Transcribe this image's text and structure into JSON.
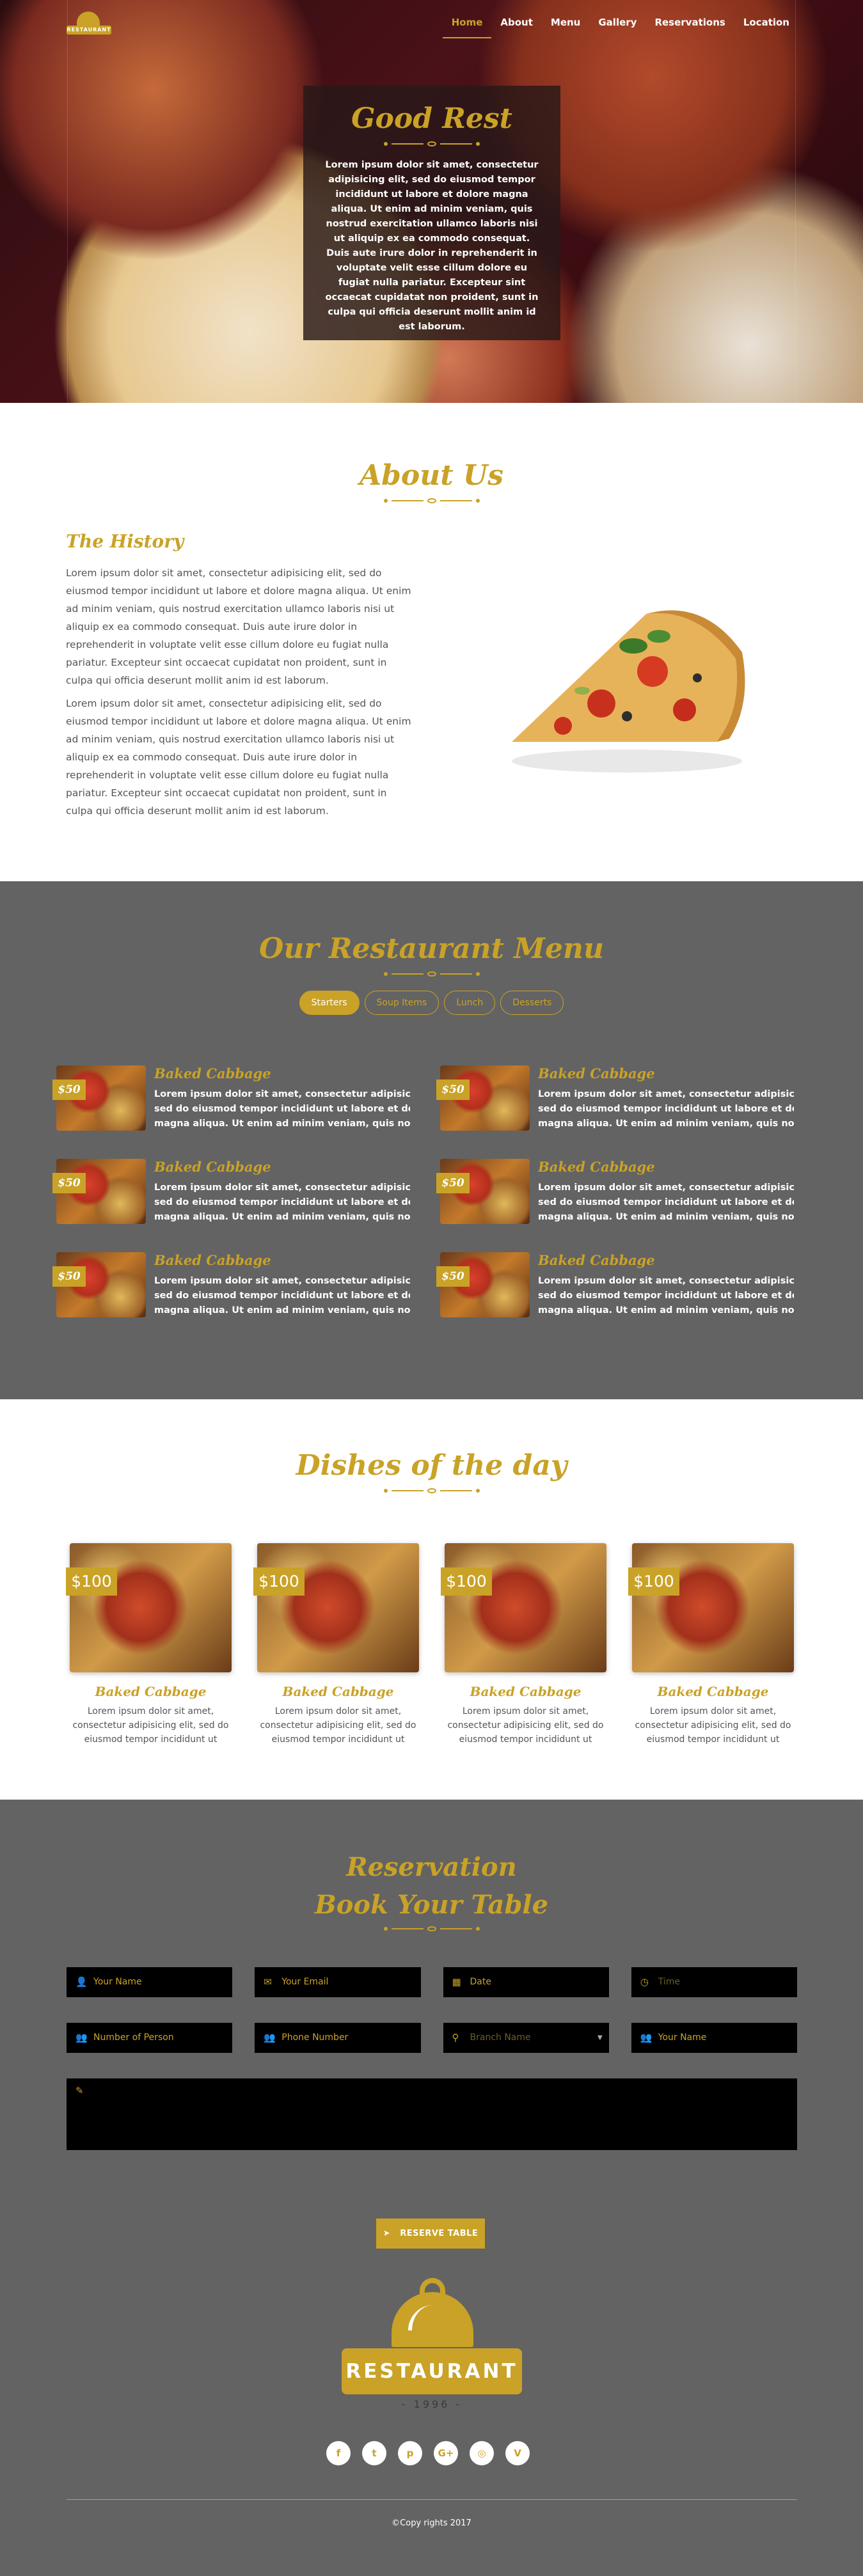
{
  "nav": {
    "logo_text": "RESTAURANT",
    "items": [
      "Home",
      "About",
      "Menu",
      "Gallery",
      "Reservations",
      "Location"
    ]
  },
  "hero": {
    "title": "Good Rest",
    "text": "Lorem ipsum dolor sit amet, consectetur adipisicing elit, sed do eiusmod tempor incididunt ut labore et dolore magna aliqua. Ut enim ad minim veniam, quis nostrud exercitation ullamco laboris nisi ut aliquip ex ea commodo consequat. Duis aute irure dolor in reprehenderit in voluptate velit esse cillum dolore eu fugiat nulla pariatur. Excepteur sint occaecat cupidatat non proident, sunt in culpa qui officia deserunt mollit anim id est laborum."
  },
  "about": {
    "title": "About Us",
    "subtitle": "The History",
    "p1": "Lorem ipsum dolor sit amet, consectetur adipisicing elit, sed do eiusmod tempor incididunt ut labore et dolore magna aliqua. Ut enim ad minim veniam, quis nostrud exercitation ullamco laboris nisi ut aliquip ex ea commodo consequat. Duis aute irure dolor in reprehenderit in voluptate velit esse cillum dolore eu fugiat nulla pariatur. Excepteur sint occaecat cupidatat non proident, sunt in culpa qui officia deserunt mollit anim id est laborum.",
    "p2": "Lorem ipsum dolor sit amet, consectetur adipisicing elit, sed do eiusmod tempor incididunt ut labore et dolore magna aliqua. Ut enim ad minim veniam, quis nostrud exercitation ullamco laboris nisi ut aliquip ex ea commodo consequat. Duis aute irure dolor in reprehenderit in voluptate velit esse cillum dolore eu fugiat nulla pariatur. Excepteur sint occaecat cupidatat non proident, sunt in culpa qui officia deserunt mollit anim id est laborum."
  },
  "menu": {
    "title": "Our Restaurant Menu",
    "tabs": [
      "Starters",
      "Soup Items",
      "Lunch",
      "Desserts"
    ],
    "items": [
      {
        "price": "$50",
        "name": "Baked Cabbage",
        "desc1": "Lorem ipsum dolor sit amet, consectetur adipisicing elit,",
        "desc2": "sed do eiusmod tempor incididunt ut labore et dolore",
        "desc3": "magna aliqua. Ut enim ad minim veniam, quis nostrud..."
      },
      {
        "price": "$50",
        "name": "Baked Cabbage",
        "desc1": "Lorem ipsum dolor sit amet, consectetur adipisicing elit,",
        "desc2": "sed do eiusmod tempor incididunt ut labore et dolore",
        "desc3": "magna aliqua. Ut enim ad minim veniam, quis nostrud..."
      },
      {
        "price": "$50",
        "name": "Baked Cabbage",
        "desc1": "Lorem ipsum dolor sit amet, consectetur adipisicing elit,",
        "desc2": "sed do eiusmod tempor incididunt ut labore et dolore",
        "desc3": "magna aliqua. Ut enim ad minim veniam, quis nostrud..."
      },
      {
        "price": "$50",
        "name": "Baked Cabbage",
        "desc1": "Lorem ipsum dolor sit amet, consectetur adipisicing elit,",
        "desc2": "sed do eiusmod tempor incididunt ut labore et dolore",
        "desc3": "magna aliqua. Ut enim ad minim veniam, quis nostrud..."
      },
      {
        "price": "$50",
        "name": "Baked Cabbage",
        "desc1": "Lorem ipsum dolor sit amet, consectetur adipisicing elit,",
        "desc2": "sed do eiusmod tempor incididunt ut labore et dolore",
        "desc3": "magna aliqua. Ut enim ad minim veniam, quis nostrud..."
      },
      {
        "price": "$50",
        "name": "Baked Cabbage",
        "desc1": "Lorem ipsum dolor sit amet, consectetur adipisicing elit,",
        "desc2": "sed do eiusmod tempor incididunt ut labore et dolore",
        "desc3": "magna aliqua. Ut enim ad minim veniam, quis nostrud..."
      }
    ]
  },
  "dishes": {
    "title": "Dishes of the day",
    "items": [
      {
        "price": "$100",
        "name": "Baked Cabbage",
        "desc": "Lorem ipsum dolor sit amet, consectetur adipisicing elit, sed do eiusmod tempor incididunt ut"
      },
      {
        "price": "$100",
        "name": "Baked Cabbage",
        "desc": "Lorem ipsum dolor sit amet, consectetur adipisicing elit, sed do eiusmod tempor incididunt ut"
      },
      {
        "price": "$100",
        "name": "Baked Cabbage",
        "desc": "Lorem ipsum dolor sit amet, consectetur adipisicing elit, sed do eiusmod tempor incididunt ut"
      },
      {
        "price": "$100",
        "name": "Baked Cabbage",
        "desc": "Lorem ipsum dolor sit amet, consectetur adipisicing elit, sed do eiusmod tempor incididunt ut"
      }
    ]
  },
  "reservation": {
    "title1": "Reservation",
    "title2": "Book Your Table",
    "fields": {
      "your_name": "Your Name",
      "your_email": "Your Email",
      "date": "Date",
      "time": "Time",
      "number_of_person": "Number of Person",
      "phone_number": "Phone Number",
      "branch_name": "Branch Name",
      "your_name_2": "Your Name"
    },
    "button": "RESERVE TABLE"
  },
  "footer": {
    "logo_text": "RESTAURANT",
    "year": "- 1996 -",
    "social": [
      "f",
      "t",
      "p",
      "G+",
      "◎",
      "V"
    ],
    "copyright": "©Copy rights 2017"
  },
  "colors": {
    "accent": "#c9a227",
    "dark_section": "#636363"
  }
}
